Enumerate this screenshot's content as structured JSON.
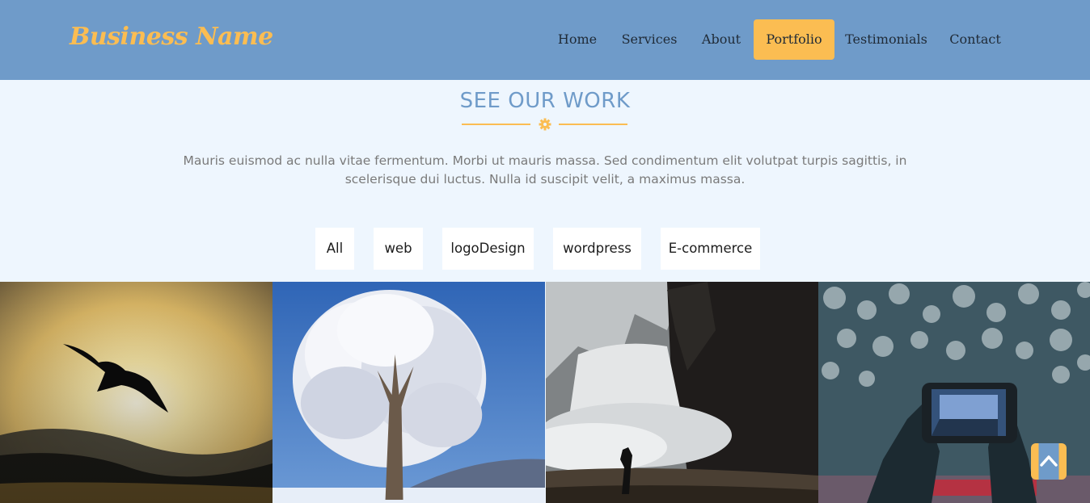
{
  "header": {
    "brand": "Business Name",
    "nav": [
      {
        "label": "Home"
      },
      {
        "label": "Services"
      },
      {
        "label": "About"
      },
      {
        "label": "Portfolio",
        "active": true
      },
      {
        "label": "Testimonials"
      },
      {
        "label": "Contact"
      }
    ]
  },
  "portfolio": {
    "title": "SEE OUR WORK",
    "description": "Mauris euismod ac nulla vitae fermentum. Morbi ut mauris massa. Sed condimentum elit volutpat turpis sagittis, in scelerisque dui luctus. Nulla id suscipit velit, a maximus massa.",
    "divider_icon": "gear-icon",
    "filters": [
      {
        "label": "All"
      },
      {
        "label": "web"
      },
      {
        "label": "logoDesign"
      },
      {
        "label": "wordpress"
      },
      {
        "label": "E-commerce"
      }
    ],
    "gallery": [
      {
        "subject": "bird-silhouette-sunset"
      },
      {
        "subject": "frosted-tree-winter"
      },
      {
        "subject": "waterfall-photographer"
      },
      {
        "subject": "phone-camera-bokeh"
      }
    ]
  },
  "scroll_top": {
    "icon": "chevron-up-icon"
  },
  "colors": {
    "header_bg": "#6f9bc9",
    "accent": "#fbbd52",
    "page_bg": "#eef6fe",
    "title": "#6f9bc9",
    "body_text": "#7a7a7a"
  }
}
